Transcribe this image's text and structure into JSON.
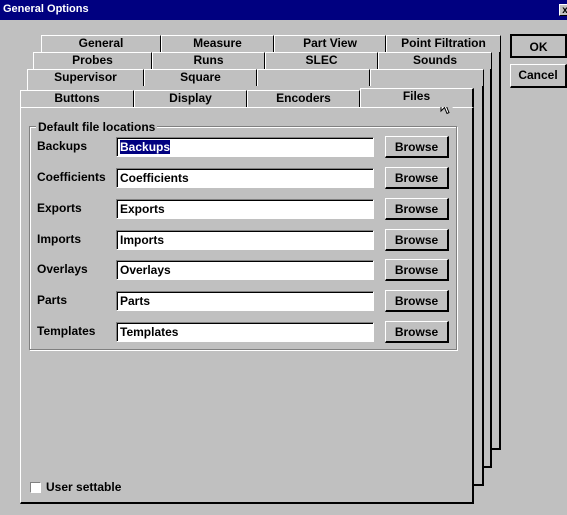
{
  "window": {
    "title": "General Options",
    "close_label": "x"
  },
  "tabs": {
    "row1": [
      "General",
      "Measure",
      "Part View",
      "Point Filtration"
    ],
    "row2": [
      "Probes",
      "Runs",
      "SLEC",
      "Sounds"
    ],
    "row3": [
      "Supervisor",
      "Square",
      "",
      ""
    ],
    "row4": [
      "Buttons",
      "Display",
      "Encoders",
      "Files"
    ],
    "active": "Files"
  },
  "buttons": {
    "ok": "OK",
    "cancel": "Cancel"
  },
  "group": {
    "label": "Default file locations",
    "browse_label": "Browse",
    "rows": [
      {
        "label": "Backups",
        "value": "Backups"
      },
      {
        "label": "Coefficients",
        "value": "Coefficients"
      },
      {
        "label": "Exports",
        "value": "Exports"
      },
      {
        "label": "Imports",
        "value": "Imports"
      },
      {
        "label": "Overlays",
        "value": "Overlays"
      },
      {
        "label": "Parts",
        "value": "Parts"
      },
      {
        "label": "Templates",
        "value": "Templates"
      }
    ]
  },
  "user_settable": {
    "label": "User settable",
    "checked": false
  }
}
